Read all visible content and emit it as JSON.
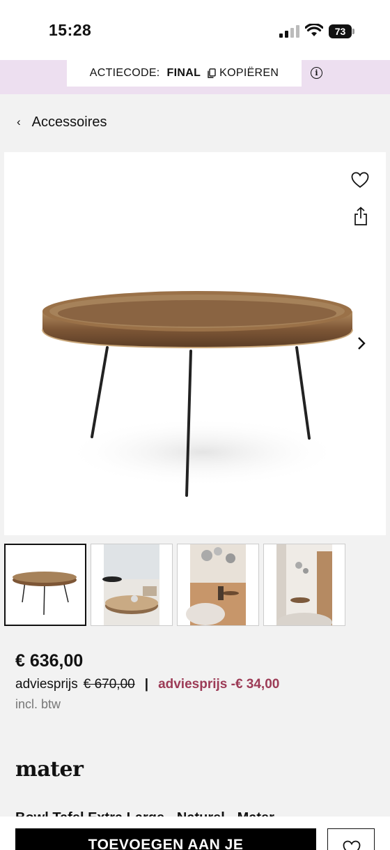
{
  "status_bar": {
    "time": "15:28",
    "battery": "73",
    "icons": [
      "cellular-signal-icon",
      "wifi-icon",
      "battery-icon"
    ]
  },
  "promo": {
    "label": "ACTIECODE:",
    "code": "FINAL",
    "copy_label": "KOPIËREN",
    "info_icon": "i"
  },
  "breadcrumb": {
    "chevron": "‹",
    "label": "Accessoires"
  },
  "gallery": {
    "icons": [
      "heart-icon",
      "share-icon",
      "chevron-right-icon"
    ],
    "thumbnail_count": 4,
    "active_thumbnail": 1
  },
  "pricing": {
    "price": "€ 636,00",
    "advice_label": "adviesprijs",
    "advice_price": "€ 670,00",
    "separator": "|",
    "discount": "adviesprijs -€ 34,00",
    "vat_note": "incl. btw"
  },
  "brand": {
    "name": "mater"
  },
  "product": {
    "title": "Bowl Tafel Extra Large - Naturel - Mater"
  },
  "actions": {
    "add_to_cart": "TOEVOEGEN AAN JE",
    "wishlist_icon": "heart-icon"
  },
  "colors": {
    "promo_background": "#eddff0",
    "discount": "#9c3b56",
    "page_background": "#f2f2f2"
  }
}
